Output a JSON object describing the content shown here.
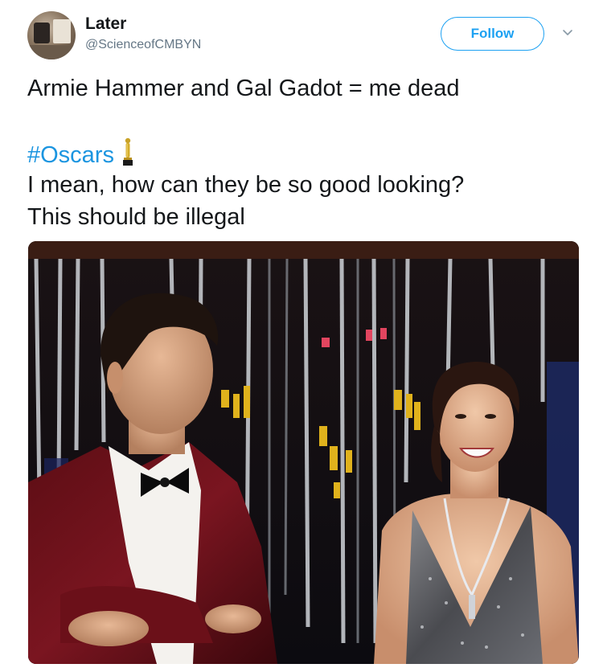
{
  "author": {
    "display_name": "Later",
    "handle": "@ScienceofCMBYN",
    "avatar_icon": "avatar-photo"
  },
  "follow_button": {
    "label": "Follow"
  },
  "menu": {
    "icon": "chevron-down-icon"
  },
  "tweet": {
    "line1": "Armie Hammer and Gal Gadot = me dead",
    "hashtag": "#Oscars",
    "emoji_icon": "oscar-statuette-icon",
    "line3": "I mean, how can they be so good looking?",
    "line4": "This should be illegal"
  },
  "media": {
    "type": "photo",
    "icon": "tv-screen-photo"
  },
  "colors": {
    "link_blue": "#1b95e0",
    "follow_blue": "#1da1f2",
    "text": "#14171a",
    "muted": "#657786"
  }
}
